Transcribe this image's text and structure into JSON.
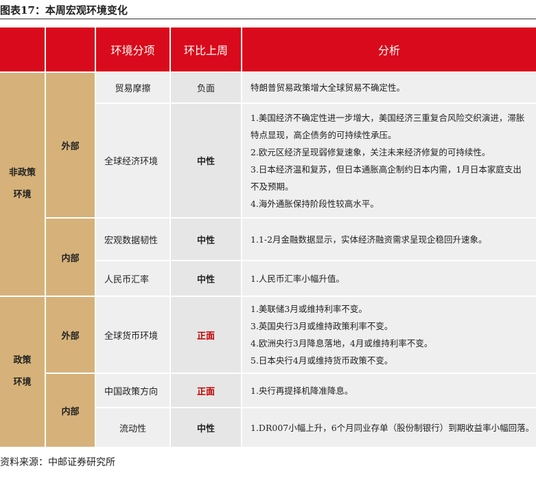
{
  "title": "图表17：本周宏观环境变化",
  "headers": {
    "col3": "环境分项",
    "col4": "环比上周",
    "col5": "分析"
  },
  "groups": {
    "nonpolicy_line1": "非政策",
    "nonpolicy_line2": "环境",
    "policy_line1": "政策",
    "policy_line2": "环境",
    "external": "外部",
    "internal": "内部"
  },
  "rows": [
    {
      "item": "贸易摩擦",
      "change": "负面",
      "analysis": [
        "特朗普贸易政策增大全球贸易不确定性。"
      ]
    },
    {
      "item": "全球经济环境",
      "change": "中性",
      "analysis": [
        "1.美国经济不确定性进一步增大，美国经济三重复合风险交织演进，滞胀",
        "特点显现，高企债务的可持续性承压。",
        "2.欧元区经济呈现弱修复速象，关注未来经济修复的可持续性。",
        "3.日本经济温和复苏，但日本通胀高企制约日本内需，1月日本家庭支出",
        "不及预期。",
        "4.海外通胀保持阶段性较高水平。"
      ]
    },
    {
      "item": "宏观数据韧性",
      "change": "中性",
      "analysis": [
        "1.1-2月金融数据显示，实体经济融资需求呈现企稳回升速象。"
      ]
    },
    {
      "item": "人民币汇率",
      "change": "中性",
      "analysis": [
        "1.人民币汇率小幅升值。"
      ]
    },
    {
      "item": "全球货币环境",
      "change": "正面",
      "analysis": [
        "1.美联储3月或维持利率不变。",
        "3.英国央行3月或维持政策利率不变。",
        "4.欧洲央行3月降息落地，4月或维持利率不变。",
        "5.日本央行4月或维持货币政策不变。"
      ]
    },
    {
      "item": "中国政策方向",
      "change": "正面",
      "analysis": [
        "1.央行再提择机降准降息。"
      ]
    },
    {
      "item": "流动性",
      "change": "中性",
      "analysis": [
        "1.DR007小幅上升，6个月同业存单（股份制银行）到期收益率小幅回落。"
      ]
    }
  ],
  "source": "资料来源：中邮证券研究所"
}
